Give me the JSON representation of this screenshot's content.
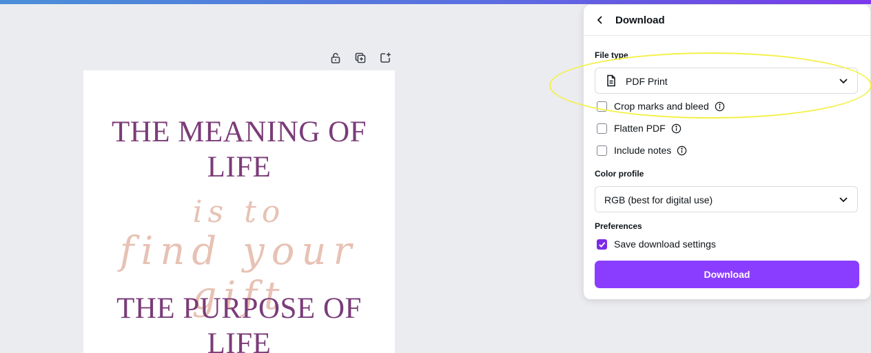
{
  "canvas": {
    "headline_1": [
      "THE MEANING OF",
      "LIFE"
    ],
    "script_1": "is to",
    "script_2": "find your gift",
    "headline_2": [
      "THE PURPOSE OF",
      "LIFE"
    ]
  },
  "page_tools": {
    "icons": [
      "lock-icon",
      "duplicate-page-icon",
      "add-page-icon"
    ]
  },
  "panel": {
    "title": "Download",
    "file_type_label": "File type",
    "file_type_value": "PDF Print",
    "options": [
      {
        "label": "Crop marks and bleed",
        "checked": false
      },
      {
        "label": "Flatten PDF",
        "checked": false
      },
      {
        "label": "Include notes",
        "checked": false
      }
    ],
    "color_profile_label": "Color profile",
    "color_profile_value": "RGB (best for digital use)",
    "preferences_label": "Preferences",
    "save_settings_label": "Save download settings",
    "save_settings_checked": true,
    "download_button": "Download"
  },
  "colors": {
    "accent": "#8b3dff",
    "headline": "#7a3c78",
    "script": "#e7c2b4",
    "highlight": "#f4f046"
  }
}
